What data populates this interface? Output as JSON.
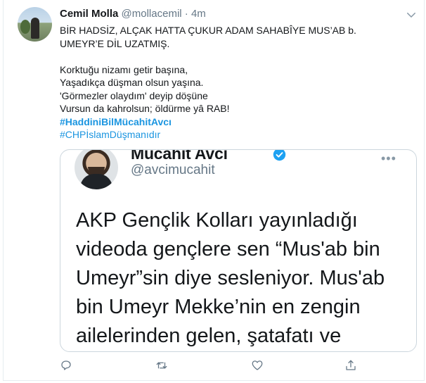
{
  "tweet": {
    "author_name": "Cemil Molla",
    "author_handle": "@mollacemil",
    "separator": "·",
    "time": "4m",
    "lines": [
      "BİR HADSİZ, ALÇAK HATTA ÇUKUR ADAM SAHABÎYE MUS’AB b.",
      "UMEYR’E DİL UZATMIŞ.",
      "",
      "Korktuğu nizamı getir başına,",
      "Yaşadıkça düşman olsun yaşına.",
      "'Görmezler olaydım' deyip döşüne",
      "Vursun da kahrolsun; öldürme yâ RAB!"
    ],
    "hashtags": [
      "#HaddiniBilMücahitAvcı",
      "#CHPİslamDüşmanıdır"
    ]
  },
  "quoted": {
    "author_name": "Mucahit Avci",
    "author_handle": "@avcimucahit",
    "more": "•••",
    "lines": [
      "AKP Gençlik Kolları yayınladığı",
      "videoda gençlere sen “Mus'ab bin",
      "Umeyr”sin diye sesleniyor. Mus'ab",
      "bin Umeyr Mekke’nin en zengin",
      "ailelerinden gelen, şatafatı ve"
    ]
  },
  "icons": {
    "reply": "reply-icon",
    "retweet": "retweet-icon",
    "like": "heart-icon",
    "share": "share-icon",
    "caret": "chevron-down-icon",
    "verified": "verified-badge-icon"
  },
  "colors": {
    "link": "#1b95e0",
    "secondary_text": "#657786",
    "border": "#ccd6dd",
    "verified": "#1da1f2"
  }
}
